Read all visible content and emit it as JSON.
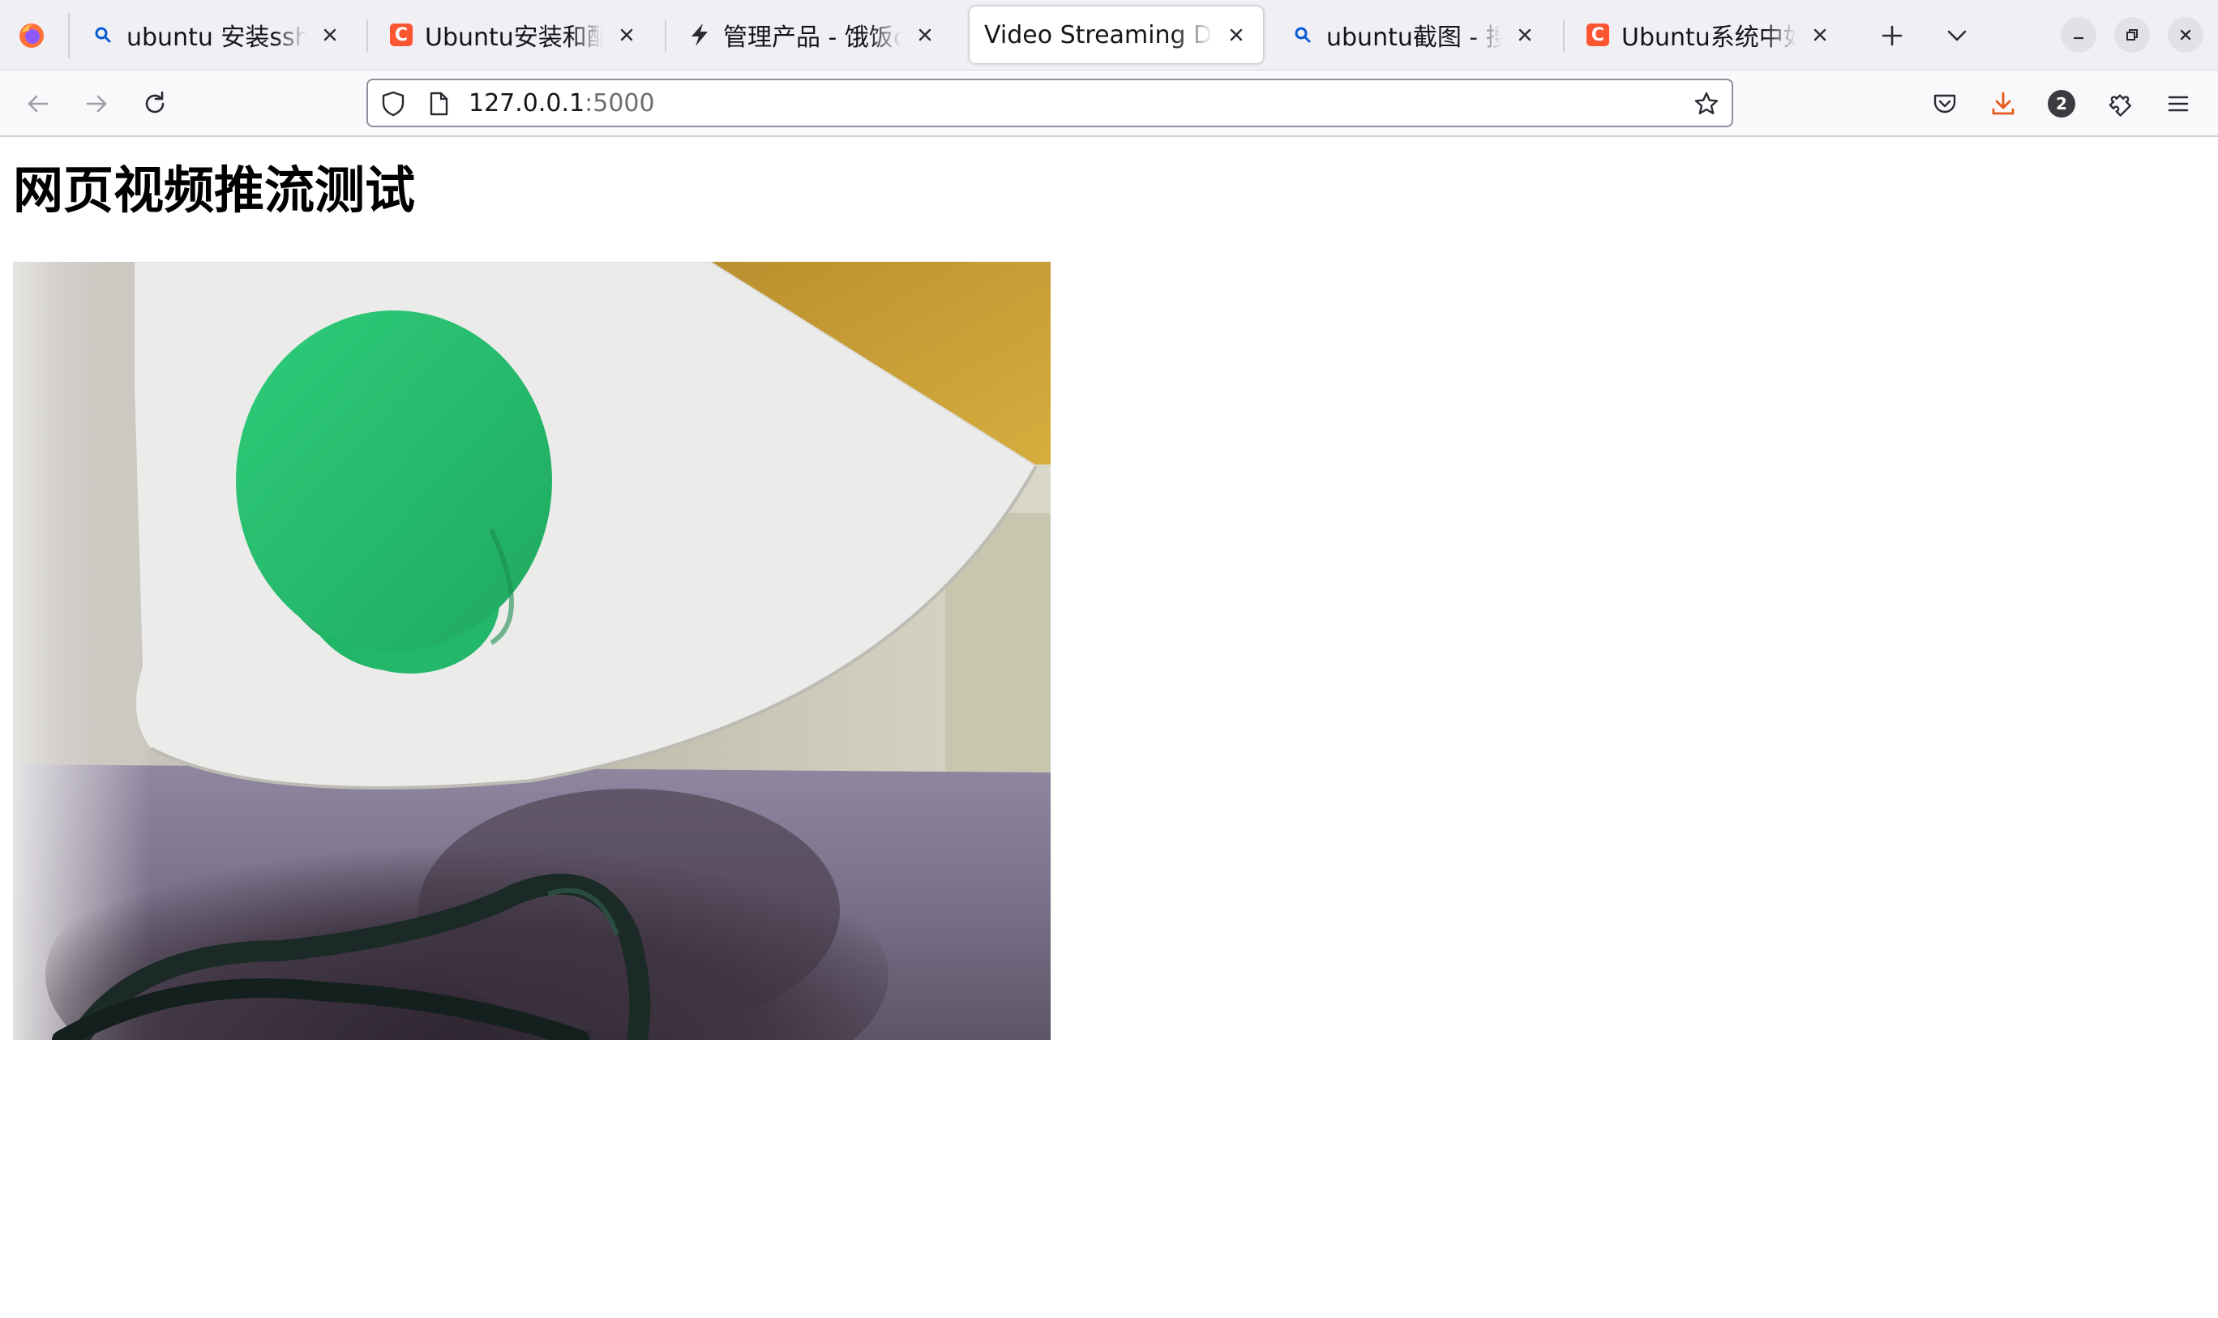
{
  "browser": {
    "tabs": [
      {
        "label": "ubuntu 安装ssh - 搜索",
        "icon": "search-icon",
        "active": false
      },
      {
        "label": "Ubuntu安装和配置ssh",
        "icon": "csdn-icon",
        "active": false
      },
      {
        "label": "管理产品 - 饿饭cc云",
        "icon": "bolt-icon",
        "active": false
      },
      {
        "label": "Video Streaming Demo",
        "icon": "",
        "active": true
      },
      {
        "label": "ubuntu截图 - 搜索",
        "icon": "search-icon",
        "active": false
      },
      {
        "label": "Ubuntu系统中如何截图",
        "icon": "csdn-icon",
        "active": false
      }
    ],
    "csdn_glyph": "C",
    "url": {
      "host": "127.0.0.1",
      "port": ":5000"
    },
    "notification_count": "2",
    "colors": {
      "download": "#e8581a",
      "csdn": "#fc5531",
      "search": "#0a5ad6"
    }
  },
  "page": {
    "heading": "网页视频推流测试",
    "video_stream": {
      "scene_colors": {
        "paper": "#ececeb",
        "cylinder": "#27bf6e",
        "cardboard": "#c8a032",
        "surface": "#8d8496",
        "shadow": "#3e3340",
        "cable": "#1f3a33"
      }
    }
  }
}
